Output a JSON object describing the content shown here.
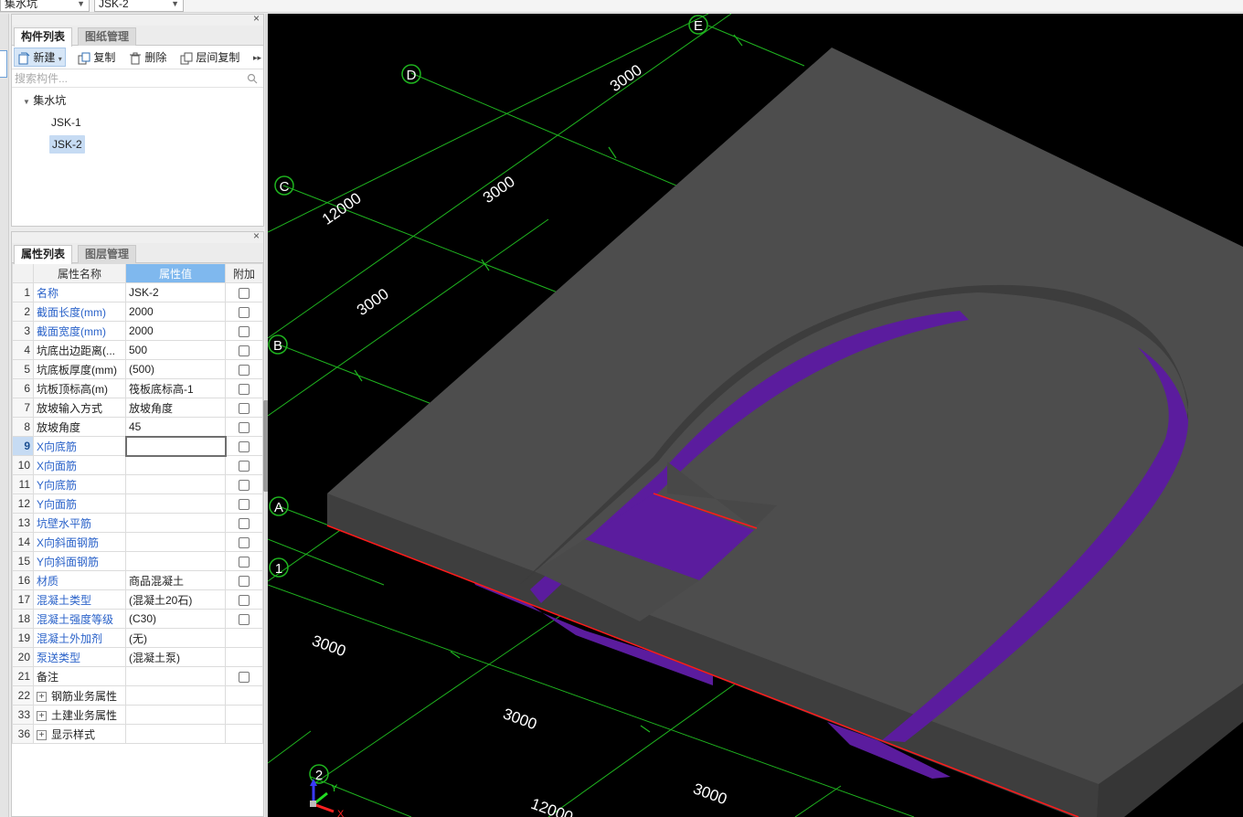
{
  "topbar": {
    "combo1": "集水坑",
    "combo2": "JSK-2"
  },
  "components_panel": {
    "tabs": [
      "构件列表",
      "图纸管理"
    ],
    "toolbar": {
      "new": "新建",
      "copy": "复制",
      "delete": "删除",
      "floor_copy": "层间复制"
    },
    "search_placeholder": "搜索构件...",
    "tree": {
      "category": "集水坑",
      "items": [
        "JSK-1",
        "JSK-2"
      ],
      "selected": "JSK-2"
    }
  },
  "properties_panel": {
    "tabs": [
      "属性列表",
      "图层管理"
    ],
    "columns": [
      "属性名称",
      "属性值",
      "附加"
    ],
    "rows": [
      {
        "num": "1",
        "name": "名称",
        "value": "JSK-2"
      },
      {
        "num": "2",
        "name": "截面长度(mm)",
        "value": "2000"
      },
      {
        "num": "3",
        "name": "截面宽度(mm)",
        "value": "2000"
      },
      {
        "num": "4",
        "name": "坑底出边距离(...",
        "value": "500"
      },
      {
        "num": "5",
        "name": "坑底板厚度(mm)",
        "value": "(500)"
      },
      {
        "num": "6",
        "name": "坑板顶标高(m)",
        "value": "筏板底标高-1"
      },
      {
        "num": "7",
        "name": "放坡输入方式",
        "value": "放坡角度"
      },
      {
        "num": "8",
        "name": "放坡角度",
        "value": "45"
      },
      {
        "num": "9",
        "name": "X向底筋",
        "value": ""
      },
      {
        "num": "10",
        "name": "X向面筋",
        "value": ""
      },
      {
        "num": "11",
        "name": "Y向底筋",
        "value": ""
      },
      {
        "num": "12",
        "name": "Y向面筋",
        "value": ""
      },
      {
        "num": "13",
        "name": "坑壁水平筋",
        "value": ""
      },
      {
        "num": "14",
        "name": "X向斜面钢筋",
        "value": ""
      },
      {
        "num": "15",
        "name": "Y向斜面钢筋",
        "value": ""
      },
      {
        "num": "16",
        "name": "材质",
        "value": "商品混凝土"
      },
      {
        "num": "17",
        "name": "混凝土类型",
        "value": "(混凝土20石)"
      },
      {
        "num": "18",
        "name": "混凝土强度等级",
        "value": "(C30)"
      },
      {
        "num": "19",
        "name": "混凝土外加剂",
        "value": "(无)"
      },
      {
        "num": "20",
        "name": "泵送类型",
        "value": "(混凝土泵)"
      },
      {
        "num": "21",
        "name": "备注",
        "value": ""
      },
      {
        "num": "22",
        "name": "钢筋业务属性",
        "value": ""
      },
      {
        "num": "33",
        "name": "土建业务属性",
        "value": ""
      },
      {
        "num": "36",
        "name": "显示样式",
        "value": ""
      }
    ]
  },
  "viewport": {
    "axis_labels": [
      "E",
      "D",
      "C",
      "B",
      "A",
      "1",
      "2"
    ],
    "dimensions": [
      "3000",
      "3000",
      "12000",
      "3000",
      "3000",
      "3000",
      "3000",
      "12000"
    ],
    "colors": {
      "grid": "#1fb41f",
      "slab": "#4d4d4d",
      "pit": "#5b1c9e",
      "edge": "#ff1a1a"
    },
    "axes_gizmo": [
      "Y",
      "X"
    ]
  }
}
